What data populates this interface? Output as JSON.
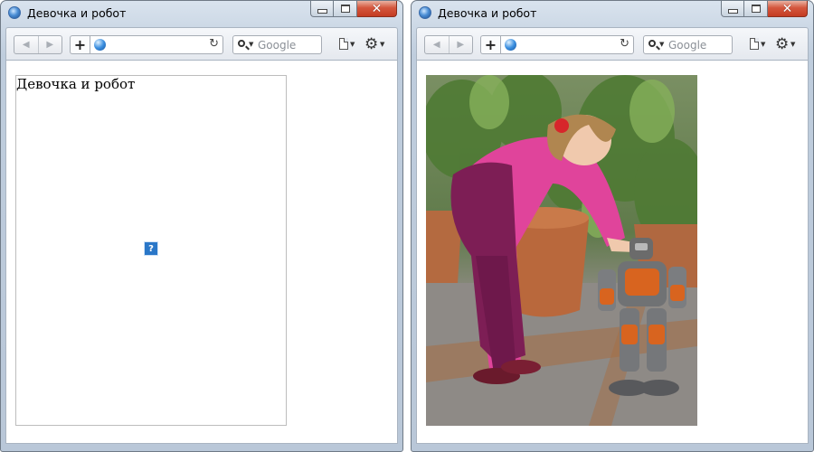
{
  "windows": [
    {
      "title": "Девочка и робот",
      "search": {
        "placeholder": "Google"
      },
      "content": {
        "alt_text": "Девочка и робот",
        "image_state": "broken"
      }
    },
    {
      "title": "Девочка и робот",
      "search": {
        "placeholder": "Google"
      },
      "content": {
        "image_state": "loaded",
        "image_subject": "girl-and-robot-photo"
      }
    }
  ],
  "icons": {
    "app": "browser-icon",
    "back": "back-arrow-icon",
    "forward": "forward-arrow-icon",
    "add": "plus-icon",
    "site": "globe-icon",
    "reload": "reload-icon",
    "search": "magnifier-icon",
    "page": "page-menu-icon",
    "tools": "gear-icon",
    "broken": "broken-image-icon"
  },
  "colors": {
    "close_button": "#c43c22",
    "broken_icon": "#2a77c8"
  }
}
